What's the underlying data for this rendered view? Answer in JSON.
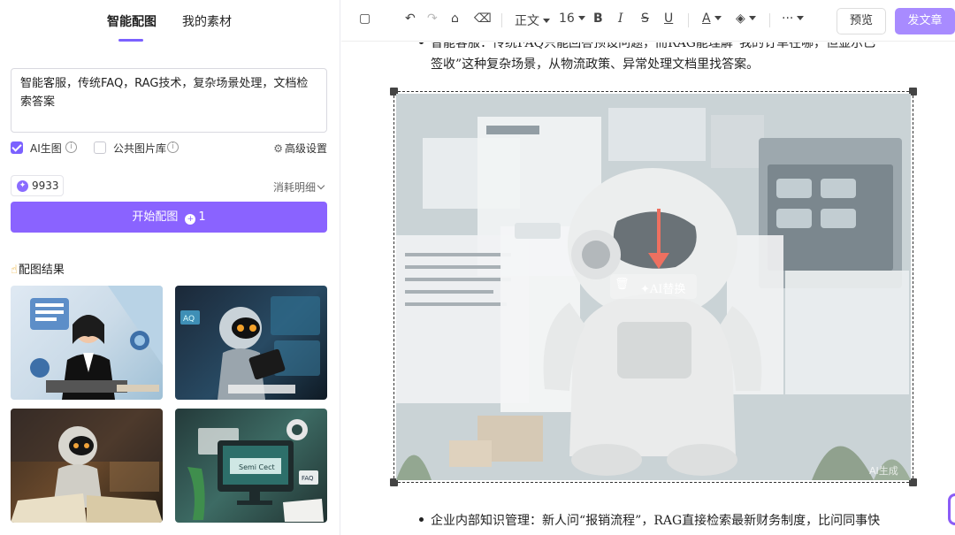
{
  "left_panel": {
    "tabs": [
      {
        "label": "智能配图",
        "active": true
      },
      {
        "label": "我的素材",
        "active": false
      }
    ],
    "prompt_text": "智能客服，传统FAQ，RAG技术，复杂场景处理，文档检索答案",
    "options": {
      "ai_image": {
        "label": "AI生图",
        "checked": true
      },
      "public_library": {
        "label": "公共图片库",
        "checked": false
      },
      "advanced": "高级设置"
    },
    "credits": "9933",
    "consume_detail": "消耗明细",
    "start_button": {
      "label": "开始配图",
      "cost": "1"
    },
    "result_title": "配图结果"
  },
  "toolbar": {
    "paragraph_style": "正文",
    "font_size": "16",
    "more": "···",
    "preview": "预览",
    "publish": "发文章"
  },
  "document": {
    "line1": "智能客服：传统FAQ只能回答预设问题，而RAG能理解“我的订单在哪，但显示已",
    "line2": "签收”这种复杂场景，从物流政策、异常处理文档里找答案。",
    "ai_replace": "AI替换",
    "watermark": "AI生成",
    "line3": "企业内部知识管理：新人问“报销流程”，RAG直接检索最新财务制度，比问同事快"
  },
  "colors": {
    "accent": "#8a63ff",
    "publish_bg": "#a88bff",
    "arrow": "#e8412b"
  }
}
